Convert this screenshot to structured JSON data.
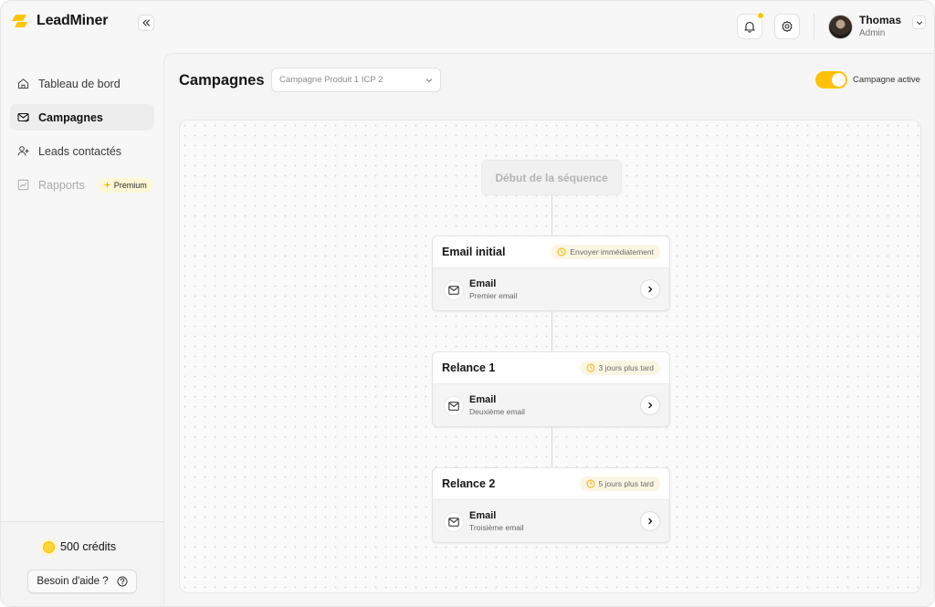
{
  "brand": {
    "name": "LeadMiner",
    "accent": "#FFC400"
  },
  "header": {
    "user": {
      "name": "Thomas",
      "role": "Admin"
    },
    "icons": [
      "bell-icon",
      "gear-icon",
      "chevron-down-icon",
      "double-chevron-left-icon"
    ]
  },
  "sidebar": {
    "items": [
      {
        "label": "Tableau de bord",
        "icon": "home-icon",
        "state": "default"
      },
      {
        "label": "Campagnes",
        "icon": "mail-check-icon",
        "state": "active"
      },
      {
        "label": "Leads contactés",
        "icon": "user-plus-icon",
        "state": "default"
      },
      {
        "label": "Rapports",
        "icon": "chart-icon",
        "state": "disabled",
        "badge": "Premium"
      }
    ],
    "credits": "500 crédits",
    "help_label": "Besoin d'aide ?"
  },
  "main": {
    "title": "Campagnes",
    "campaign_select": "Campagne Produit 1 ICP 2",
    "toggle": {
      "label": "Campagne active",
      "on": true
    },
    "sequence_start": "Début de la séquence",
    "steps": [
      {
        "title": "Email initial",
        "timing": "Envoyer immédiatement",
        "type": "Email",
        "desc": "Premier email"
      },
      {
        "title": "Relance 1",
        "timing": "3 jours plus tard",
        "type": "Email",
        "desc": "Deuxième email"
      },
      {
        "title": "Relance 2",
        "timing": "5 jours plus tard",
        "type": "Email",
        "desc": "Troisième email"
      }
    ]
  }
}
